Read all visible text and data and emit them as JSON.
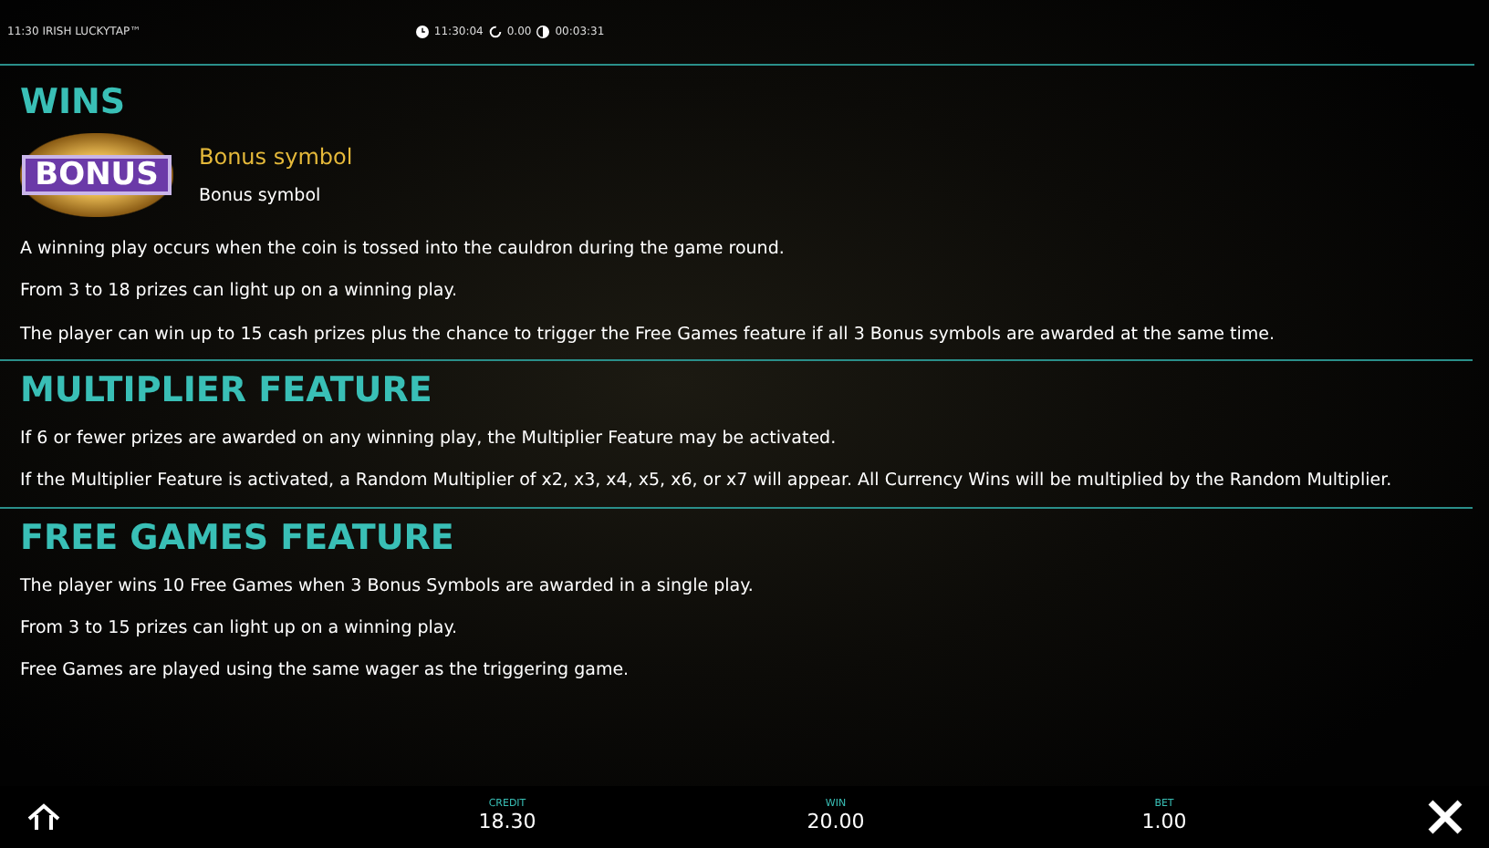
{
  "status_bar": {
    "title": "11:30 IRISH LUCKYTAP™",
    "clock": "11:30:04",
    "balance": "0.00",
    "session": "00:03:31"
  },
  "sections": [
    {
      "heading": "WINS",
      "symbol": {
        "badge": "BONUS",
        "caption": "Bonus symbol",
        "description": "Bonus symbol"
      },
      "paragraphs": [
        "A winning play occurs when the coin is tossed into the cauldron during the game round.",
        "From 3 to 18 prizes can light up on a winning play.",
        "The player can win up to 15 cash prizes plus the chance to trigger the Free Games feature if all 3 Bonus symbols are awarded at the same time."
      ]
    },
    {
      "heading": "MULTIPLIER FEATURE",
      "paragraphs": [
        "If 6 or fewer prizes are awarded on any winning play, the Multiplier Feature may be activated.",
        "If the Multiplier Feature is activated, a Random Multiplier of x2, x3, x4, x5, x6, or x7 will appear. All Currency Wins will be multiplied by the Random Multiplier."
      ]
    },
    {
      "heading": "FREE GAMES FEATURE",
      "paragraphs": [
        "The player wins 10 Free Games when 3 Bonus Symbols are awarded in a single play.",
        "From 3 to 15 prizes can light up on a winning play.",
        "Free Games are played using the same wager as the triggering game."
      ]
    }
  ],
  "footer": {
    "meters": [
      {
        "label": "CREDIT",
        "value": "18.30"
      },
      {
        "label": "WIN",
        "value": "20.00"
      },
      {
        "label": "BET",
        "value": "1.00"
      }
    ]
  }
}
